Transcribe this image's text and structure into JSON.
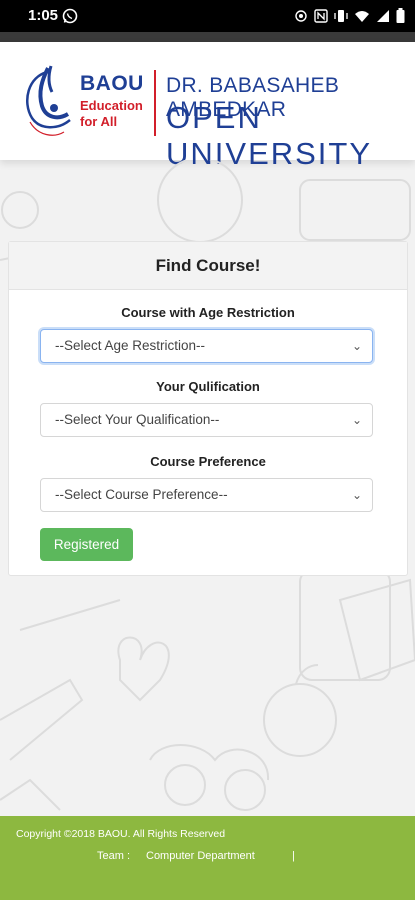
{
  "status_bar": {
    "time": "1:05",
    "icons": [
      "whatsapp-icon",
      "hotspot-icon",
      "nfc-icon",
      "vibrate-icon",
      "wifi-icon",
      "signal-icon",
      "battery-icon"
    ]
  },
  "header": {
    "brand_short": "BAOU",
    "tagline_line1": "Education",
    "tagline_line2": "for All",
    "title_line1": "DR. BABASAHEB AMBEDKAR",
    "title_line2": "OPEN UNIVERSITY",
    "colors": {
      "brand_blue": "#1f3f95",
      "brand_red": "#d21f2a"
    }
  },
  "card": {
    "title": "Find Course!",
    "fields": [
      {
        "label": "Course with Age Restriction",
        "selected": "--Select Age Restriction--"
      },
      {
        "label": "Your Qulification",
        "selected": "--Select Your Qualification--"
      },
      {
        "label": "Course Preference",
        "selected": "--Select Course Preference--"
      }
    ],
    "submit_label": "Registered",
    "colors": {
      "button": "#5cb85c"
    }
  },
  "footer": {
    "copyright": "Copyright ©2018 BAOU. All Rights Reserved",
    "team_label": "Team :",
    "team_value": "Computer Department",
    "separator": "|",
    "colors": {
      "background": "#8db840"
    }
  }
}
